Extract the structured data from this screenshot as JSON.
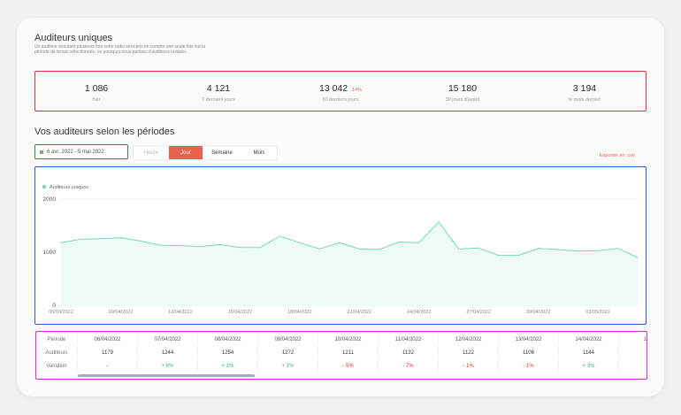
{
  "header": {
    "title": "Auditeurs uniques",
    "description": "Un auditeur écoutant plusieurs fois votre radio sera pris en compte une seule fois sur la période de temps sélectionnée, ce pourquoi nous parlons d'auditeurs uniques."
  },
  "stats": [
    {
      "value": "1 086",
      "label": "hier",
      "badge": ""
    },
    {
      "value": "4 121",
      "label": "7 derniers jours",
      "badge": ""
    },
    {
      "value": "13 042",
      "label": "30 derniers jours",
      "badge": "-14%"
    },
    {
      "value": "15 180",
      "label": "30 jours d'avant",
      "badge": ""
    },
    {
      "value": "3 194",
      "label": "le mois dernier",
      "badge": ""
    }
  ],
  "periods_section": {
    "title": "Vos auditeurs selon les périodes",
    "date_range": "6 avr. 2022 - 5 mai 2022",
    "granularity": [
      {
        "label": "Heure",
        "state": "disabled"
      },
      {
        "label": "Jour",
        "state": "active"
      },
      {
        "label": "Semaine",
        "state": "normal"
      },
      {
        "label": "Mois",
        "state": "normal"
      }
    ],
    "export_label": "Exporter en .csv"
  },
  "chart_data": {
    "type": "area",
    "legend": "Auditeurs uniques",
    "legend_position": "top-left",
    "color": "#7dd9b3",
    "ylim": [
      0,
      2000
    ],
    "yticks": [
      0,
      1000,
      2000
    ],
    "grid": true,
    "x_tick_labels": [
      "06/04/2022",
      "09/04/2022",
      "12/04/2022",
      "15/04/2022",
      "18/04/2022",
      "21/04/2022",
      "24/04/2022",
      "27/04/2022",
      "30/04/2022",
      "03/05/2022"
    ],
    "x": [
      "06/04/2022",
      "07/04/2022",
      "08/04/2022",
      "09/04/2022",
      "10/04/2022",
      "11/04/2022",
      "12/04/2022",
      "13/04/2022",
      "14/04/2022",
      "15/04/2022",
      "16/04/2022",
      "17/04/2022",
      "18/04/2022",
      "19/04/2022",
      "20/04/2022",
      "21/04/2022",
      "22/04/2022",
      "23/04/2022",
      "24/04/2022",
      "25/04/2022",
      "26/04/2022",
      "27/04/2022",
      "28/04/2022",
      "29/04/2022",
      "30/04/2022",
      "01/05/2022",
      "02/05/2022",
      "03/05/2022",
      "04/05/2022",
      "05/05/2022"
    ],
    "values": [
      1179,
      1244,
      1254,
      1272,
      1211,
      1132,
      1122,
      1106,
      1144,
      1090,
      1088,
      1300,
      1180,
      1060,
      1180,
      1060,
      1050,
      1190,
      1180,
      1570,
      1060,
      1080,
      940,
      940,
      1070,
      1050,
      1020,
      1030,
      1070,
      900
    ]
  },
  "table": {
    "row_labels": [
      "Période",
      "Auditeurs",
      "Variation"
    ],
    "dates": [
      "06/04/2022",
      "07/04/2022",
      "08/04/2022",
      "09/04/2022",
      "10/04/2022",
      "11/04/2022",
      "12/04/2022",
      "13/04/2022",
      "14/04/2022",
      "15/0"
    ],
    "listeners": [
      "1179",
      "1244",
      "1254",
      "1272",
      "1211",
      "1132",
      "1122",
      "1106",
      "1144",
      ""
    ],
    "variations": [
      "-",
      "+ 6%",
      "+ 1%",
      "+ 1%",
      "- 5%",
      "- 7%",
      "- 1%",
      "- 1%",
      "+ 3%",
      "-"
    ]
  }
}
